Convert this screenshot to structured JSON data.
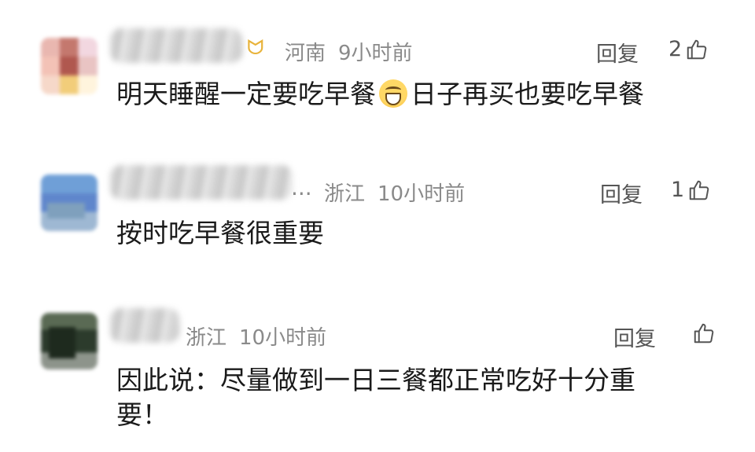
{
  "comments": [
    {
      "location": "河南",
      "time": "9小时前",
      "reply_label": "回复",
      "likes": "2",
      "text_before": "明天睡醒一定要吃早餐",
      "emoji": "grinning-face-icon",
      "text_after": "日子再买也要吃早餐"
    },
    {
      "location": "浙江",
      "time": "10小时前",
      "name_suffix": "...",
      "reply_label": "回复",
      "likes": "1",
      "text": "按时吃早餐很重要"
    },
    {
      "location": "浙江",
      "time": "10小时前",
      "reply_label": "回复",
      "likes": "",
      "text_line1": "因此说：尽量做到一日三餐都正常吃好十分重",
      "text_line2": "要！"
    }
  ],
  "colors": {
    "meta_gray": "#8a8a8a",
    "text": "#1a1a1a",
    "vip_gold": "#e8b33b"
  }
}
